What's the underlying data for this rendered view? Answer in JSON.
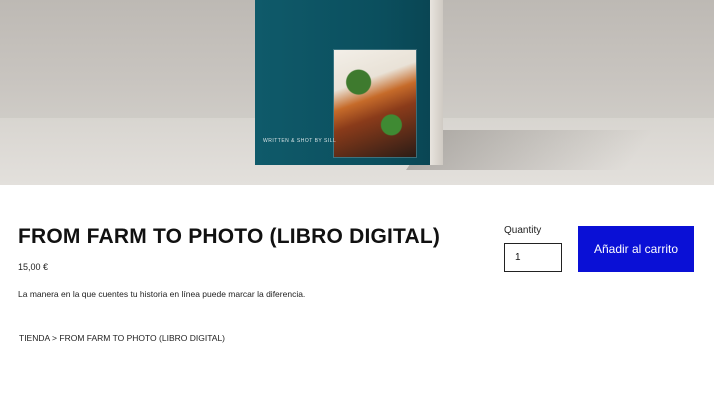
{
  "hero": {
    "book_credit": "WRITTEN & SHOT BY SILL"
  },
  "product": {
    "title": "FROM FARM TO PHOTO (LIBRO DIGITAL)",
    "price": "15,00 €",
    "description": "La manera en la que cuentes tu historia en línea puede marcar la diferencia."
  },
  "purchase": {
    "quantity_label": "Quantity",
    "quantity_value": "1",
    "add_to_cart_label": "Añadir al carrito"
  },
  "breadcrumb": {
    "text": "TIENDA > FROM FARM TO PHOTO (LIBRO DIGITAL)"
  },
  "colors": {
    "accent": "#0a10d6",
    "book_cover": "#0f5a6a"
  }
}
